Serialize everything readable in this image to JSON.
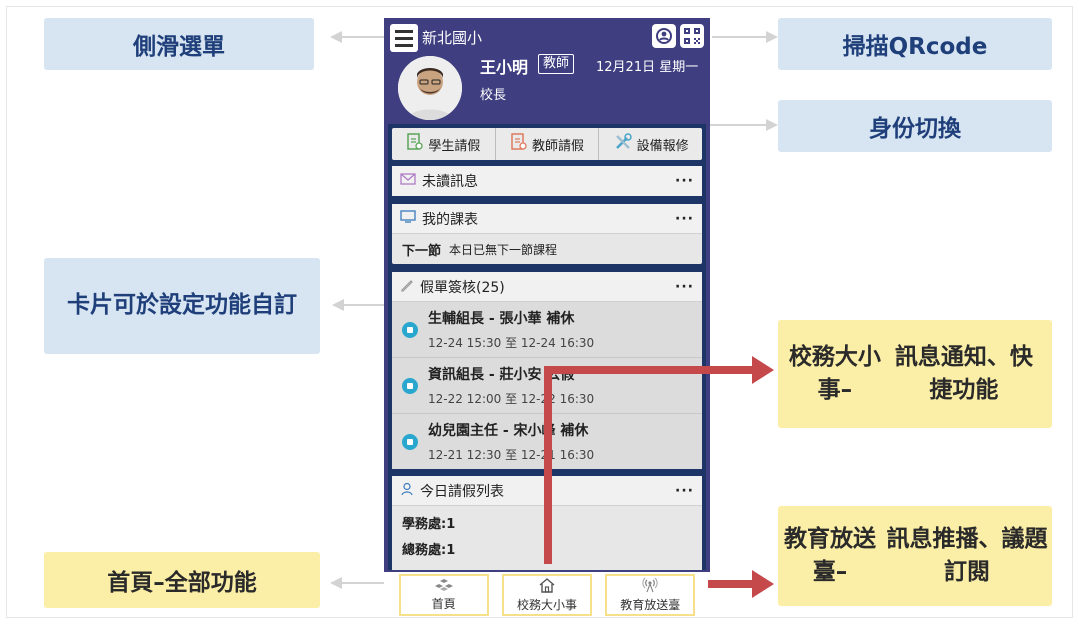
{
  "callouts": {
    "side_menu": "側滑選單",
    "scan_qr": "掃描QRcode",
    "identity_switch": "身份切換",
    "card_custom": [
      "卡片可於設",
      "定功能自訂"
    ],
    "campus_matters": [
      "校務大小事–",
      "訊息通知、快捷功能"
    ],
    "edu_broadcast": [
      "教育放送臺–",
      "訊息推播、議題訂閱"
    ],
    "home_all": "首頁–全部功能"
  },
  "header": {
    "school": "新北國小",
    "user_name": "王小明",
    "role": "教師",
    "date": "12月21日 星期一",
    "title": "校長"
  },
  "quick_actions": [
    {
      "label": "學生請假",
      "icon": "student-leave-icon"
    },
    {
      "label": "教師請假",
      "icon": "teacher-leave-icon"
    },
    {
      "label": "設備報修",
      "icon": "tools-icon"
    }
  ],
  "cards": {
    "unread": {
      "title": "未讀訊息",
      "more": "···"
    },
    "schedule": {
      "title": "我的課表",
      "more": "···",
      "next_label": "下一節",
      "next_text": "本日已無下一節課程"
    },
    "leave_review": {
      "title": "假單簽核(25)",
      "more": "···",
      "items": [
        {
          "name": "生輔組長 - 張小華 補休",
          "time": "12-24 15:30 至 12-24 16:30"
        },
        {
          "name": "資訊組長 - 莊小安 公假",
          "time": "12-22 12:00 至 12-22 16:30"
        },
        {
          "name": "幼兒園主任 - 宋小峰 補休",
          "time": "12-21 12:30 至 12-21 16:30"
        }
      ]
    },
    "today_leave": {
      "title": "今日請假列表",
      "more": "···",
      "row1": "學務處:1",
      "row2": "總務處:1"
    }
  },
  "tabs": [
    {
      "label": "首頁",
      "icon": "home-cubes-icon"
    },
    {
      "label": "校務大小事",
      "icon": "house-icon"
    },
    {
      "label": "教育放送臺",
      "icon": "broadcast-icon"
    }
  ],
  "colors": {
    "header": "#3e3e80",
    "body": "#1d3566",
    "callout_blue": "#d7e4f2",
    "callout_yellow": "#fbeea6",
    "arrow_red": "#c5484b",
    "accent_dot": "#2aa7cf"
  }
}
